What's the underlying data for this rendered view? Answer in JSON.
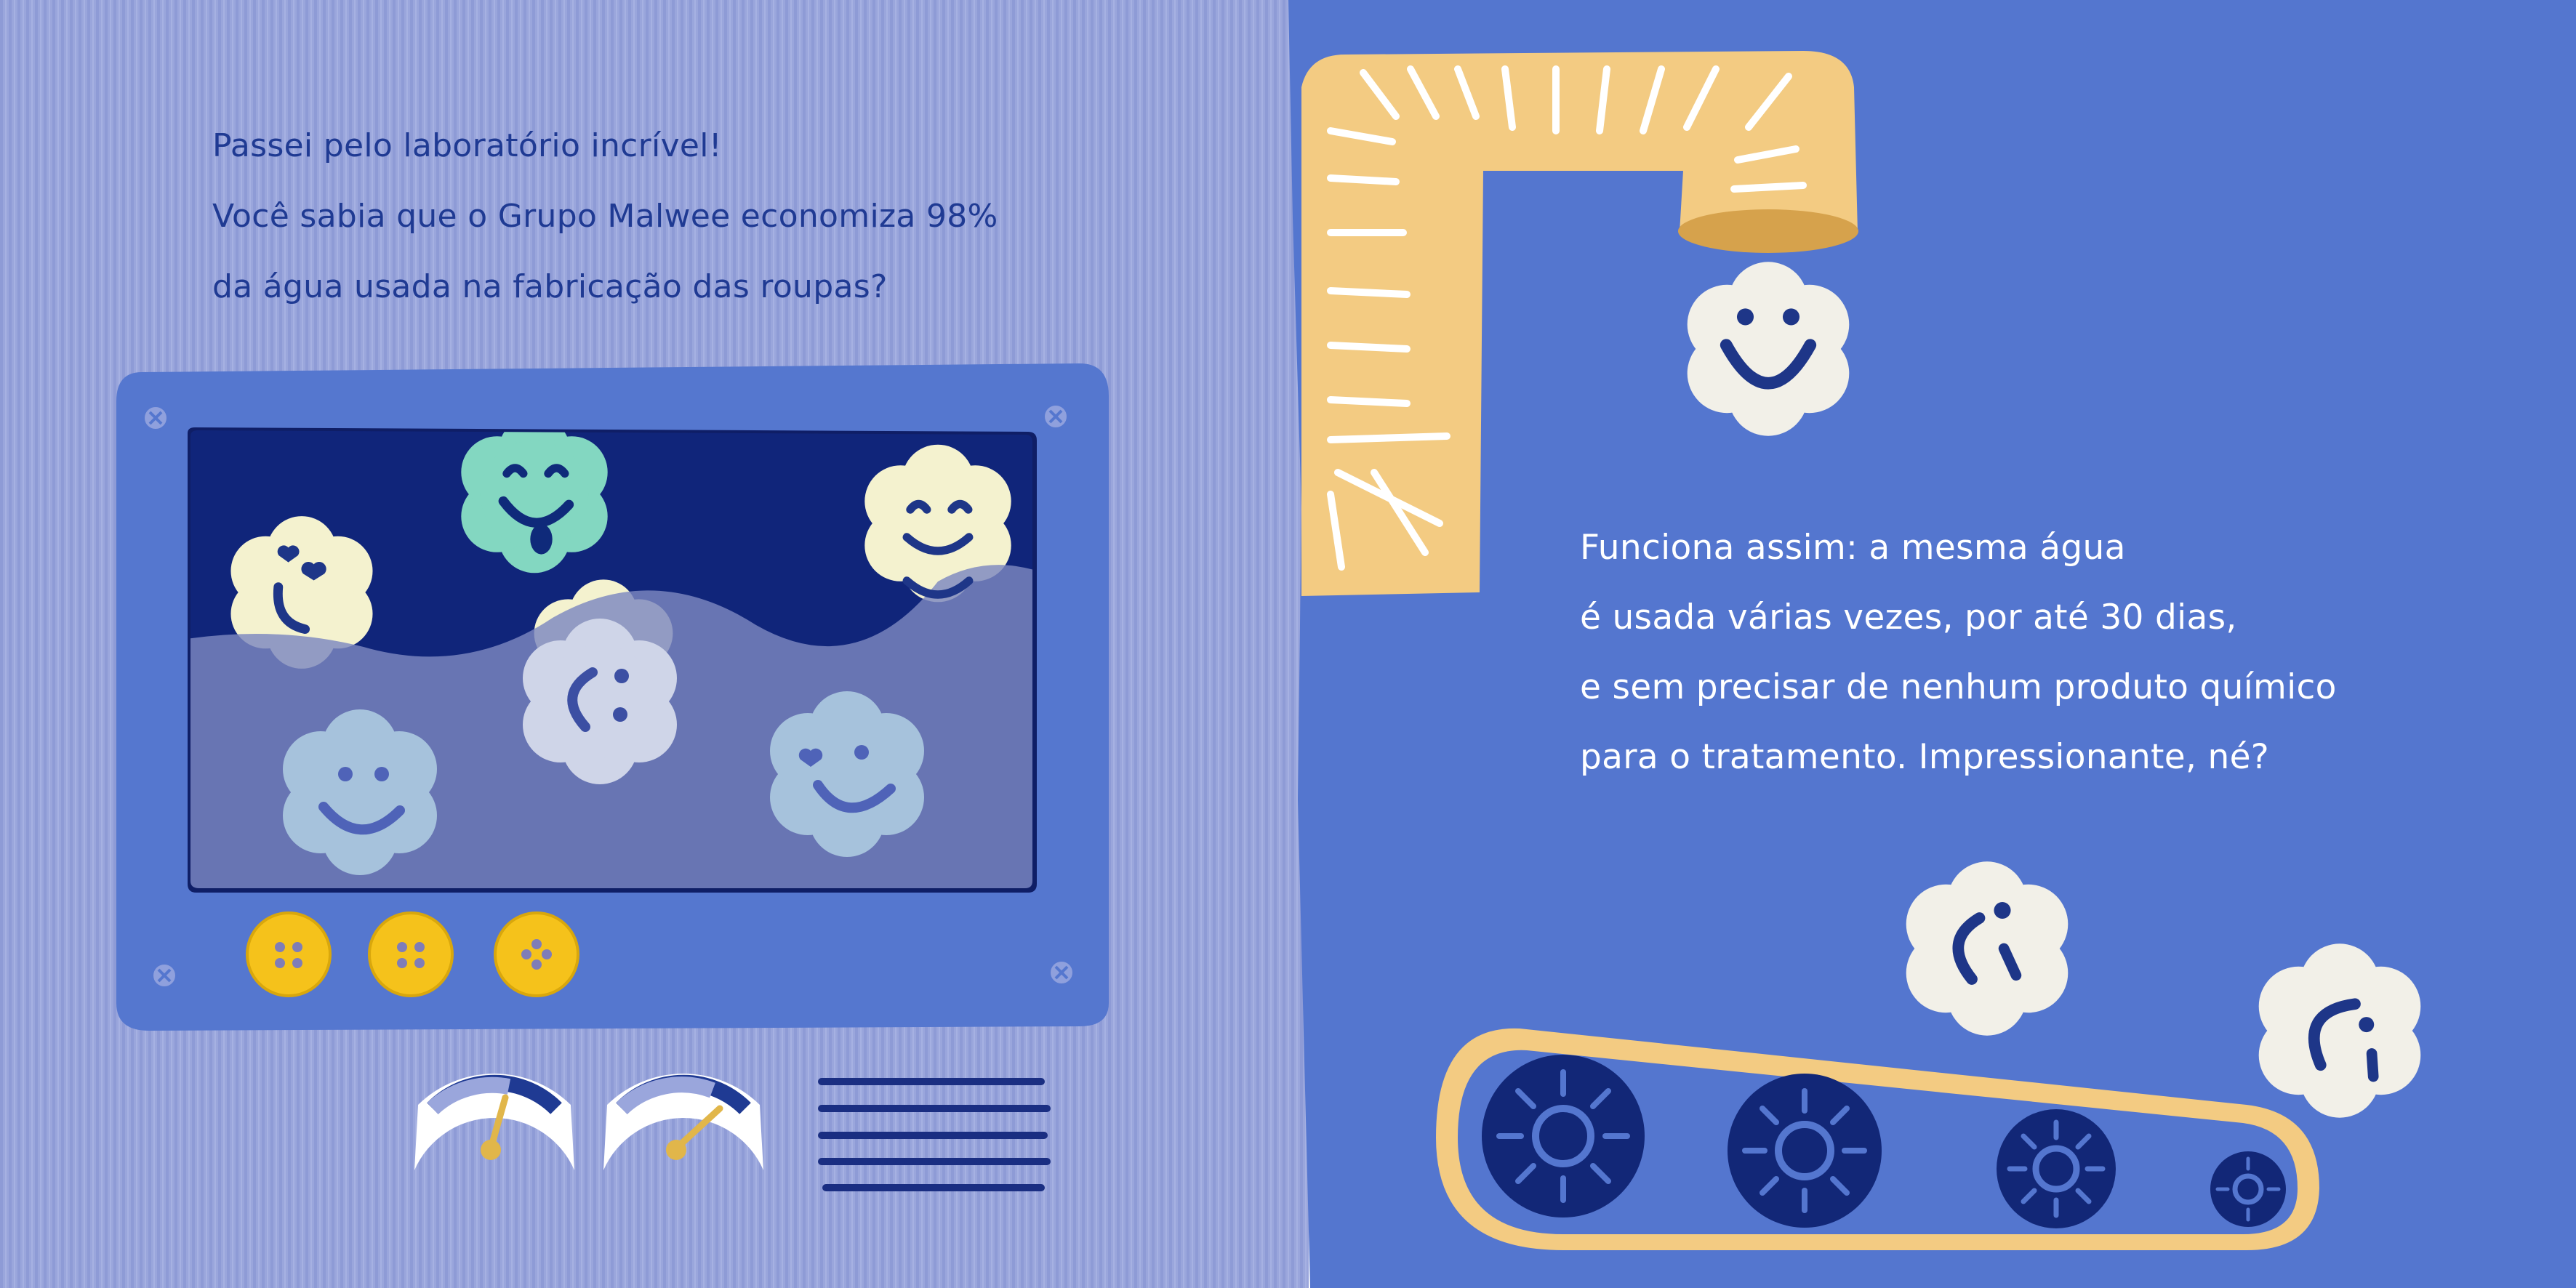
{
  "left_page": {
    "lines": [
      "Passei pelo laboratório incrível!",
      "Você sabia que o Grupo  Malwee economiza 98%",
      "da água usada na fabricação das roupas?"
    ]
  },
  "right_page": {
    "lines": [
      "Funciona assim: a mesma água",
      "é usada várias vezes, por até 30 dias,",
      "e sem precisar de nenhum produto químico",
      "para o tratamento. Impressionante, né?"
    ]
  },
  "machine": {
    "gauge_levels": [
      0.58,
      0.68
    ]
  },
  "colors": {
    "left_background": "#9aa6dc",
    "right_background": "#5476cf",
    "machine_body": "#5577cf",
    "machine_window": "#10257a",
    "water": "#7d87c0",
    "pipe": "#f3cb82",
    "cloud_white": "#f1f0e9",
    "text_dark": "#1f3a93",
    "text_light": "#ffffff",
    "button_yellow": "#f5c21b"
  }
}
